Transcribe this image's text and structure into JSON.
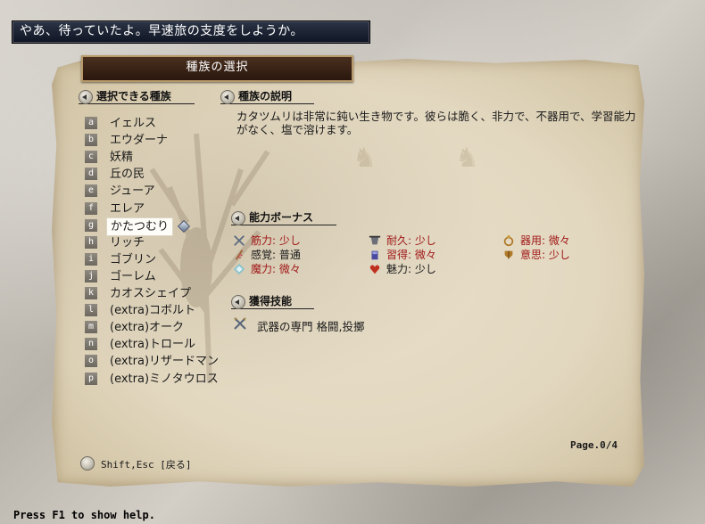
{
  "message": "やあ、待っていたよ。早速旅の支度をしようか。",
  "window_title": "種族の選択",
  "race_list": {
    "heading": "選択できる種族",
    "selected_index": 6,
    "items": [
      {
        "key": "a",
        "label": "イェルス"
      },
      {
        "key": "b",
        "label": "エウダーナ"
      },
      {
        "key": "c",
        "label": "妖精"
      },
      {
        "key": "d",
        "label": "丘の民"
      },
      {
        "key": "e",
        "label": "ジューア"
      },
      {
        "key": "f",
        "label": "エレア"
      },
      {
        "key": "g",
        "label": "かたつむり"
      },
      {
        "key": "h",
        "label": "リッチ"
      },
      {
        "key": "i",
        "label": "ゴブリン"
      },
      {
        "key": "j",
        "label": "ゴーレム"
      },
      {
        "key": "k",
        "label": "カオスシェイプ"
      },
      {
        "key": "l",
        "label": "(extra)コボルト"
      },
      {
        "key": "m",
        "label": "(extra)オーク"
      },
      {
        "key": "n",
        "label": "(extra)トロール"
      },
      {
        "key": "o",
        "label": "(extra)リザードマン"
      },
      {
        "key": "p",
        "label": "(extra)ミノタウロス"
      }
    ]
  },
  "description": {
    "heading": "種族の説明",
    "text": "カタツムリは非常に鈍い生き物です。彼らは脆く、非力で、不器用で、学習能力がなく、塩で溶けます。"
  },
  "bonus": {
    "heading": "能力ボーナス",
    "items": [
      {
        "label": "筋力: 少し",
        "icon": "sword-icon",
        "color": "#a01818"
      },
      {
        "label": "耐久: 少し",
        "icon": "armor-icon",
        "color": "#a01818"
      },
      {
        "label": "器用: 微々",
        "icon": "ring-icon",
        "color": "#a01818"
      },
      {
        "label": "感覚: 普通",
        "icon": "feather-icon",
        "color": "#1a1a1a"
      },
      {
        "label": "習得: 微々",
        "icon": "book-icon",
        "color": "#a01818"
      },
      {
        "label": "意思: 少し",
        "icon": "shield-icon",
        "color": "#a01818"
      },
      {
        "label": "魔力: 微々",
        "icon": "magic-icon",
        "color": "#a01818"
      },
      {
        "label": "魅力: 少し",
        "icon": "heart-icon",
        "color": "#1a1a1a"
      }
    ]
  },
  "skills": {
    "heading": "獲得技能",
    "text": "武器の専門  格闘,投擲"
  },
  "page": "Page.0/4",
  "hint": "Shift,Esc [戻る]",
  "help": "Press F1 to show help."
}
